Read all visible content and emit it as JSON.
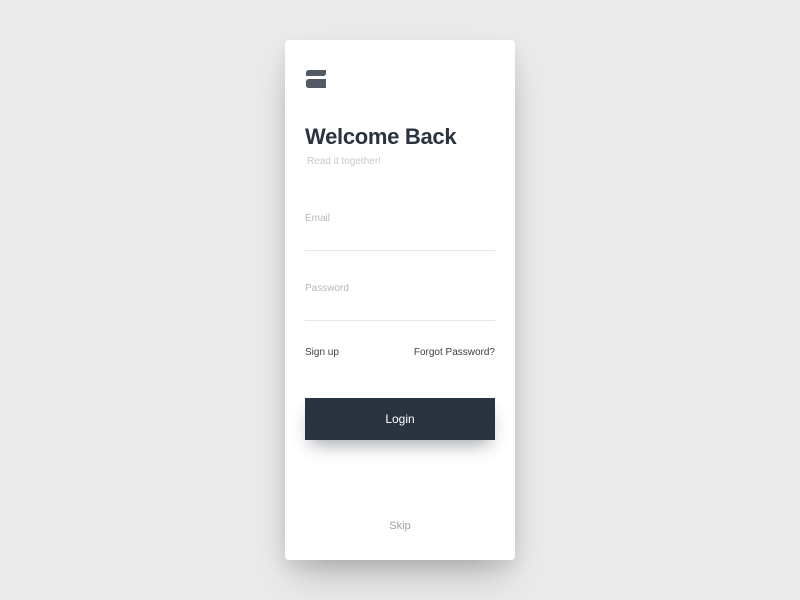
{
  "header": {
    "title": "Welcome Back",
    "subtitle": "Read it together!"
  },
  "form": {
    "email_label": "Email",
    "email_value": "",
    "password_label": "Password",
    "password_value": ""
  },
  "links": {
    "signup": "Sign up",
    "forgot": "Forgot Password?"
  },
  "buttons": {
    "login": "Login",
    "skip": "Skip"
  },
  "colors": {
    "dark": "#2a3340",
    "muted": "#b6b8bb",
    "bg": "#ebebeb"
  }
}
